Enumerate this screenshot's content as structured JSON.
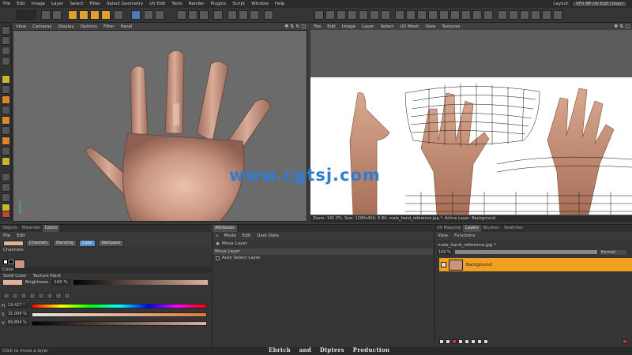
{
  "menu": [
    "File",
    "Edit",
    "Image",
    "Layer",
    "Select",
    "Filter",
    "Select Geometry",
    "UV Edit",
    "Tools",
    "Render",
    "Plugins",
    "Script",
    "Window",
    "Help"
  ],
  "layout": {
    "label": "Layout:",
    "value": "VFX BP UV Edit (User)"
  },
  "viewport3d": {
    "menu": [
      "View",
      "Cameras",
      "Display",
      "Options",
      "Filter",
      "Panel"
    ]
  },
  "uvview": {
    "menu": [
      "File",
      "Edit",
      "Image",
      "Layer",
      "Select",
      "UV Mesh",
      "View",
      "Textures"
    ],
    "status": "Zoom: 141.3%, Size: 1280x404, 8 Bit, male_hand_reference.jpg *, Active Layer: Background"
  },
  "watermark": "www.cgtsj.com",
  "objects_panel": {
    "tabs": [
      "Objects",
      "Materials",
      "Colors"
    ],
    "active_tab": "Colors",
    "menu": [
      "File",
      "Edit"
    ],
    "subtabs": [
      "Channels",
      "Blending",
      "Color",
      "Wallpaper"
    ],
    "selected_subtab": "Color",
    "channels_label": "Channels",
    "color_header": "Color",
    "solid_color": "Solid Color",
    "texture_paint": "Texture Paint",
    "brightness_label": "Brightness",
    "brightness_value": "100 %",
    "h_label": "H",
    "h_value": "19.427 °",
    "s_label": "S",
    "s_value": "31.004 %",
    "v_label": "V",
    "v_value": "89.804 %",
    "swatch_color": "#e0b19b"
  },
  "attributes_panel": {
    "tab": "Attributes",
    "menu": [
      "Mode",
      "Edit",
      "User Data"
    ],
    "tool_title": "Move Layer",
    "section_header": "Move Layer",
    "option": "Auto Select Layer"
  },
  "layers_panel": {
    "tabs": [
      "UV Mapping",
      "Layers",
      "Brushes",
      "Swatches"
    ],
    "active_tab": "Layers",
    "menu": [
      "View",
      "Functions"
    ],
    "filename": "male_hand_reference.jpg *",
    "opacity": "100 %",
    "blend_mode": "Normal",
    "layer_name": "Background",
    "layer_color": "#f0a020"
  },
  "statusbar": {
    "text": "Click to move a layer"
  },
  "credit": [
    "Ehrich",
    "and",
    "Dipters",
    "Production"
  ]
}
